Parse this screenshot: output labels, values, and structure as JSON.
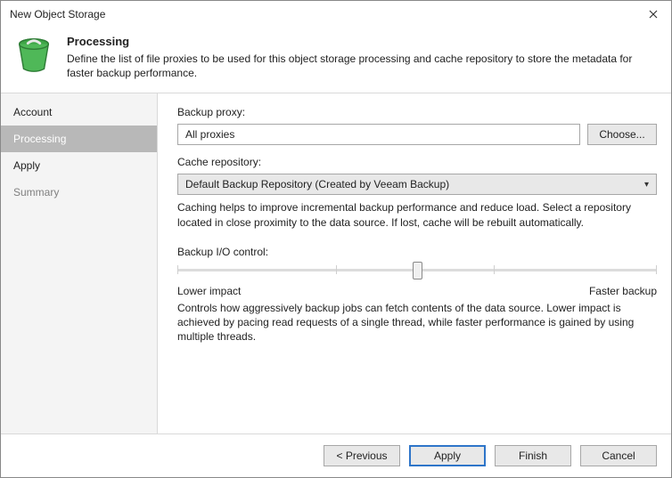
{
  "window": {
    "title": "New Object Storage"
  },
  "header": {
    "title": "Processing",
    "desc": "Define the list of file proxies to be used for this object storage processing and cache repository to store the metadata for faster backup performance."
  },
  "sidebar": {
    "items": [
      {
        "label": "Account"
      },
      {
        "label": "Processing"
      },
      {
        "label": "Apply"
      },
      {
        "label": "Summary"
      }
    ]
  },
  "content": {
    "proxy_label": "Backup proxy:",
    "proxy_value": "All proxies",
    "choose_label": "Choose...",
    "cache_label": "Cache repository:",
    "cache_value": "Default Backup Repository (Created by Veeam Backup)",
    "cache_help": "Caching helps to improve incremental backup performance and reduce load. Select a repository located in close proximity to the data source. If lost, cache will be rebuilt automatically.",
    "io_label": "Backup I/O control:",
    "io_low": "Lower impact",
    "io_high": "Faster backup",
    "io_help": "Controls how aggressively backup jobs can fetch contents of the data source. Lower impact is achieved by pacing read requests of a single thread, while faster performance is gained by using multiple threads.",
    "slider": {
      "position_pct": 50,
      "ticks": 4
    }
  },
  "footer": {
    "previous": "< Previous",
    "apply": "Apply",
    "finish": "Finish",
    "cancel": "Cancel"
  }
}
